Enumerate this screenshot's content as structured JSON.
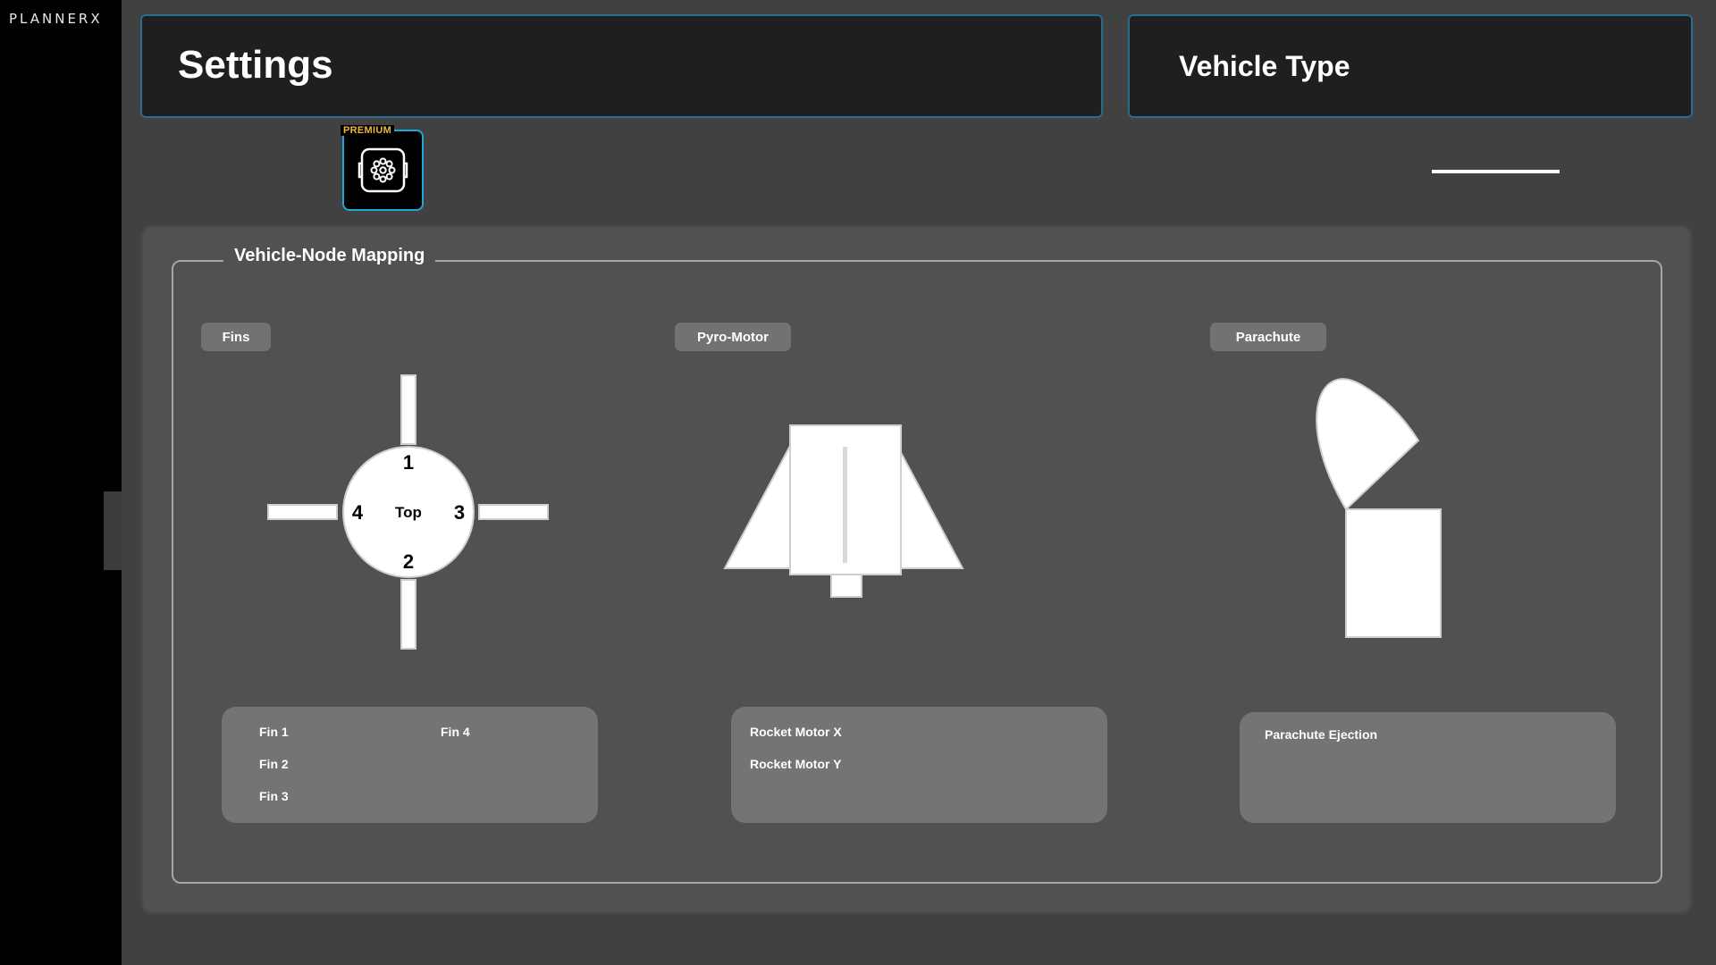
{
  "app": {
    "logo": "PLANNERX"
  },
  "header": {
    "settings_title": "Settings",
    "vehicle_type_title": "Vehicle Type"
  },
  "premium": {
    "badge": "PREMIUM",
    "icon": "flight-controller-icon"
  },
  "mapping": {
    "legend": "Vehicle-Node Mapping",
    "tabs": [
      {
        "label": "Fins"
      },
      {
        "label": "Pyro-Motor"
      },
      {
        "label": "Parachute"
      }
    ],
    "fins_diagram": {
      "center_label": "Top",
      "numbers": [
        "1",
        "2",
        "3",
        "4"
      ]
    },
    "fins_list": [
      "Fin 1",
      "Fin 2",
      "Fin 3",
      "Fin 4"
    ],
    "motor_list": [
      "Rocket Motor X",
      "Rocket Motor Y"
    ],
    "parachute_list": [
      "Parachute Ejection"
    ]
  },
  "colors": {
    "accent_border": "#2b6c8c",
    "premium_border": "#1fa8d6",
    "premium_badge": "#f2b53c",
    "panel_bg": "#515151",
    "list_bg": "#747474"
  }
}
